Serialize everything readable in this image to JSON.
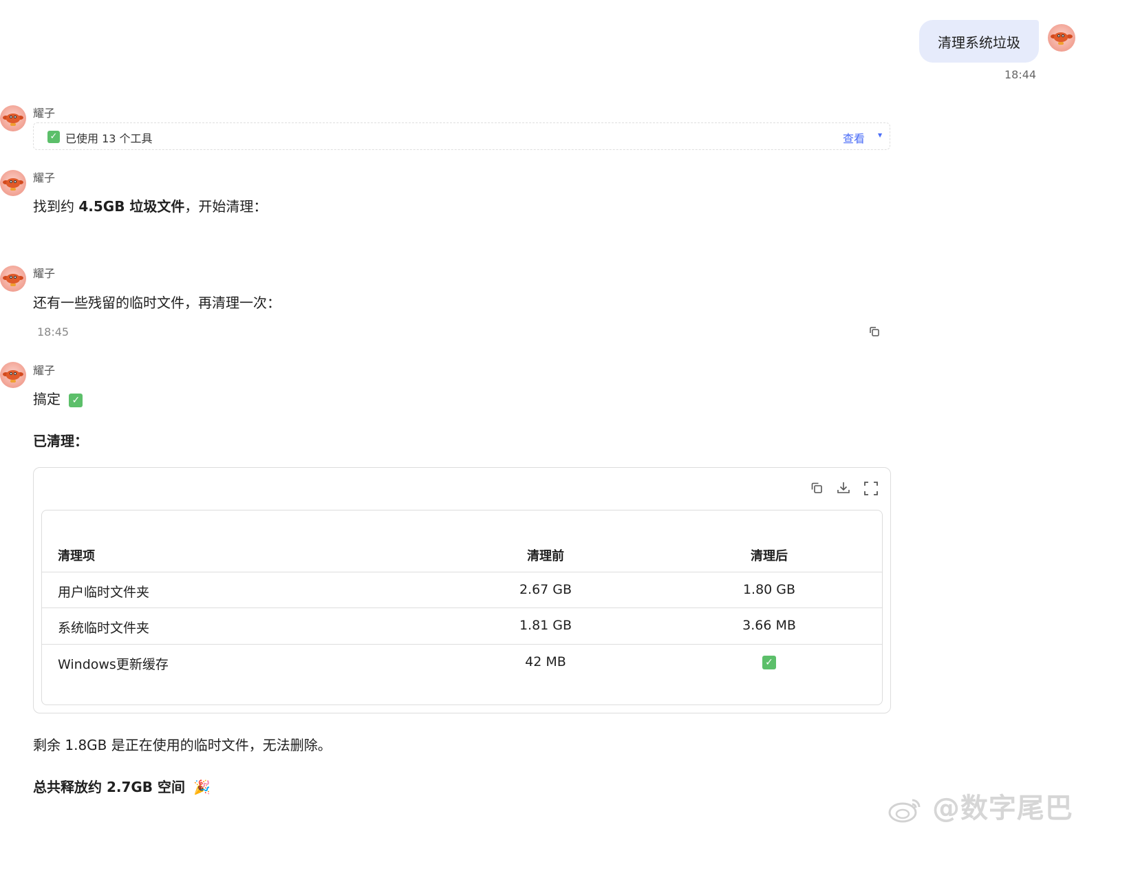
{
  "user_message": {
    "text": "清理系统垃圾",
    "time": "18:44"
  },
  "bot_name": "耀子",
  "tools": {
    "label": "已使用 13 个工具",
    "view_label": "查看"
  },
  "msg1": {
    "prefix": "找到约 ",
    "bold": "4.5GB 垃圾文件",
    "suffix": "，开始清理："
  },
  "msg2": {
    "text": "还有一些残留的临时文件，再清理一次：",
    "time": "18:45"
  },
  "msg3": {
    "done": "搞定",
    "section_title": "已清理：",
    "table": {
      "headers": [
        "清理项",
        "清理前",
        "清理后"
      ],
      "rows": [
        [
          "用户临时文件夹",
          "2.67 GB",
          "1.80 GB"
        ],
        [
          "系统临时文件夹",
          "1.81 GB",
          "3.66 MB"
        ],
        [
          "Windows更新缓存",
          "42 MB",
          "✅"
        ]
      ]
    },
    "remaining": "剩余 1.8GB 是正在使用的临时文件，无法删除。",
    "total": "总共释放约 2.7GB 空间",
    "total_emoji": "🎉"
  },
  "watermark": "@数字尾巴"
}
